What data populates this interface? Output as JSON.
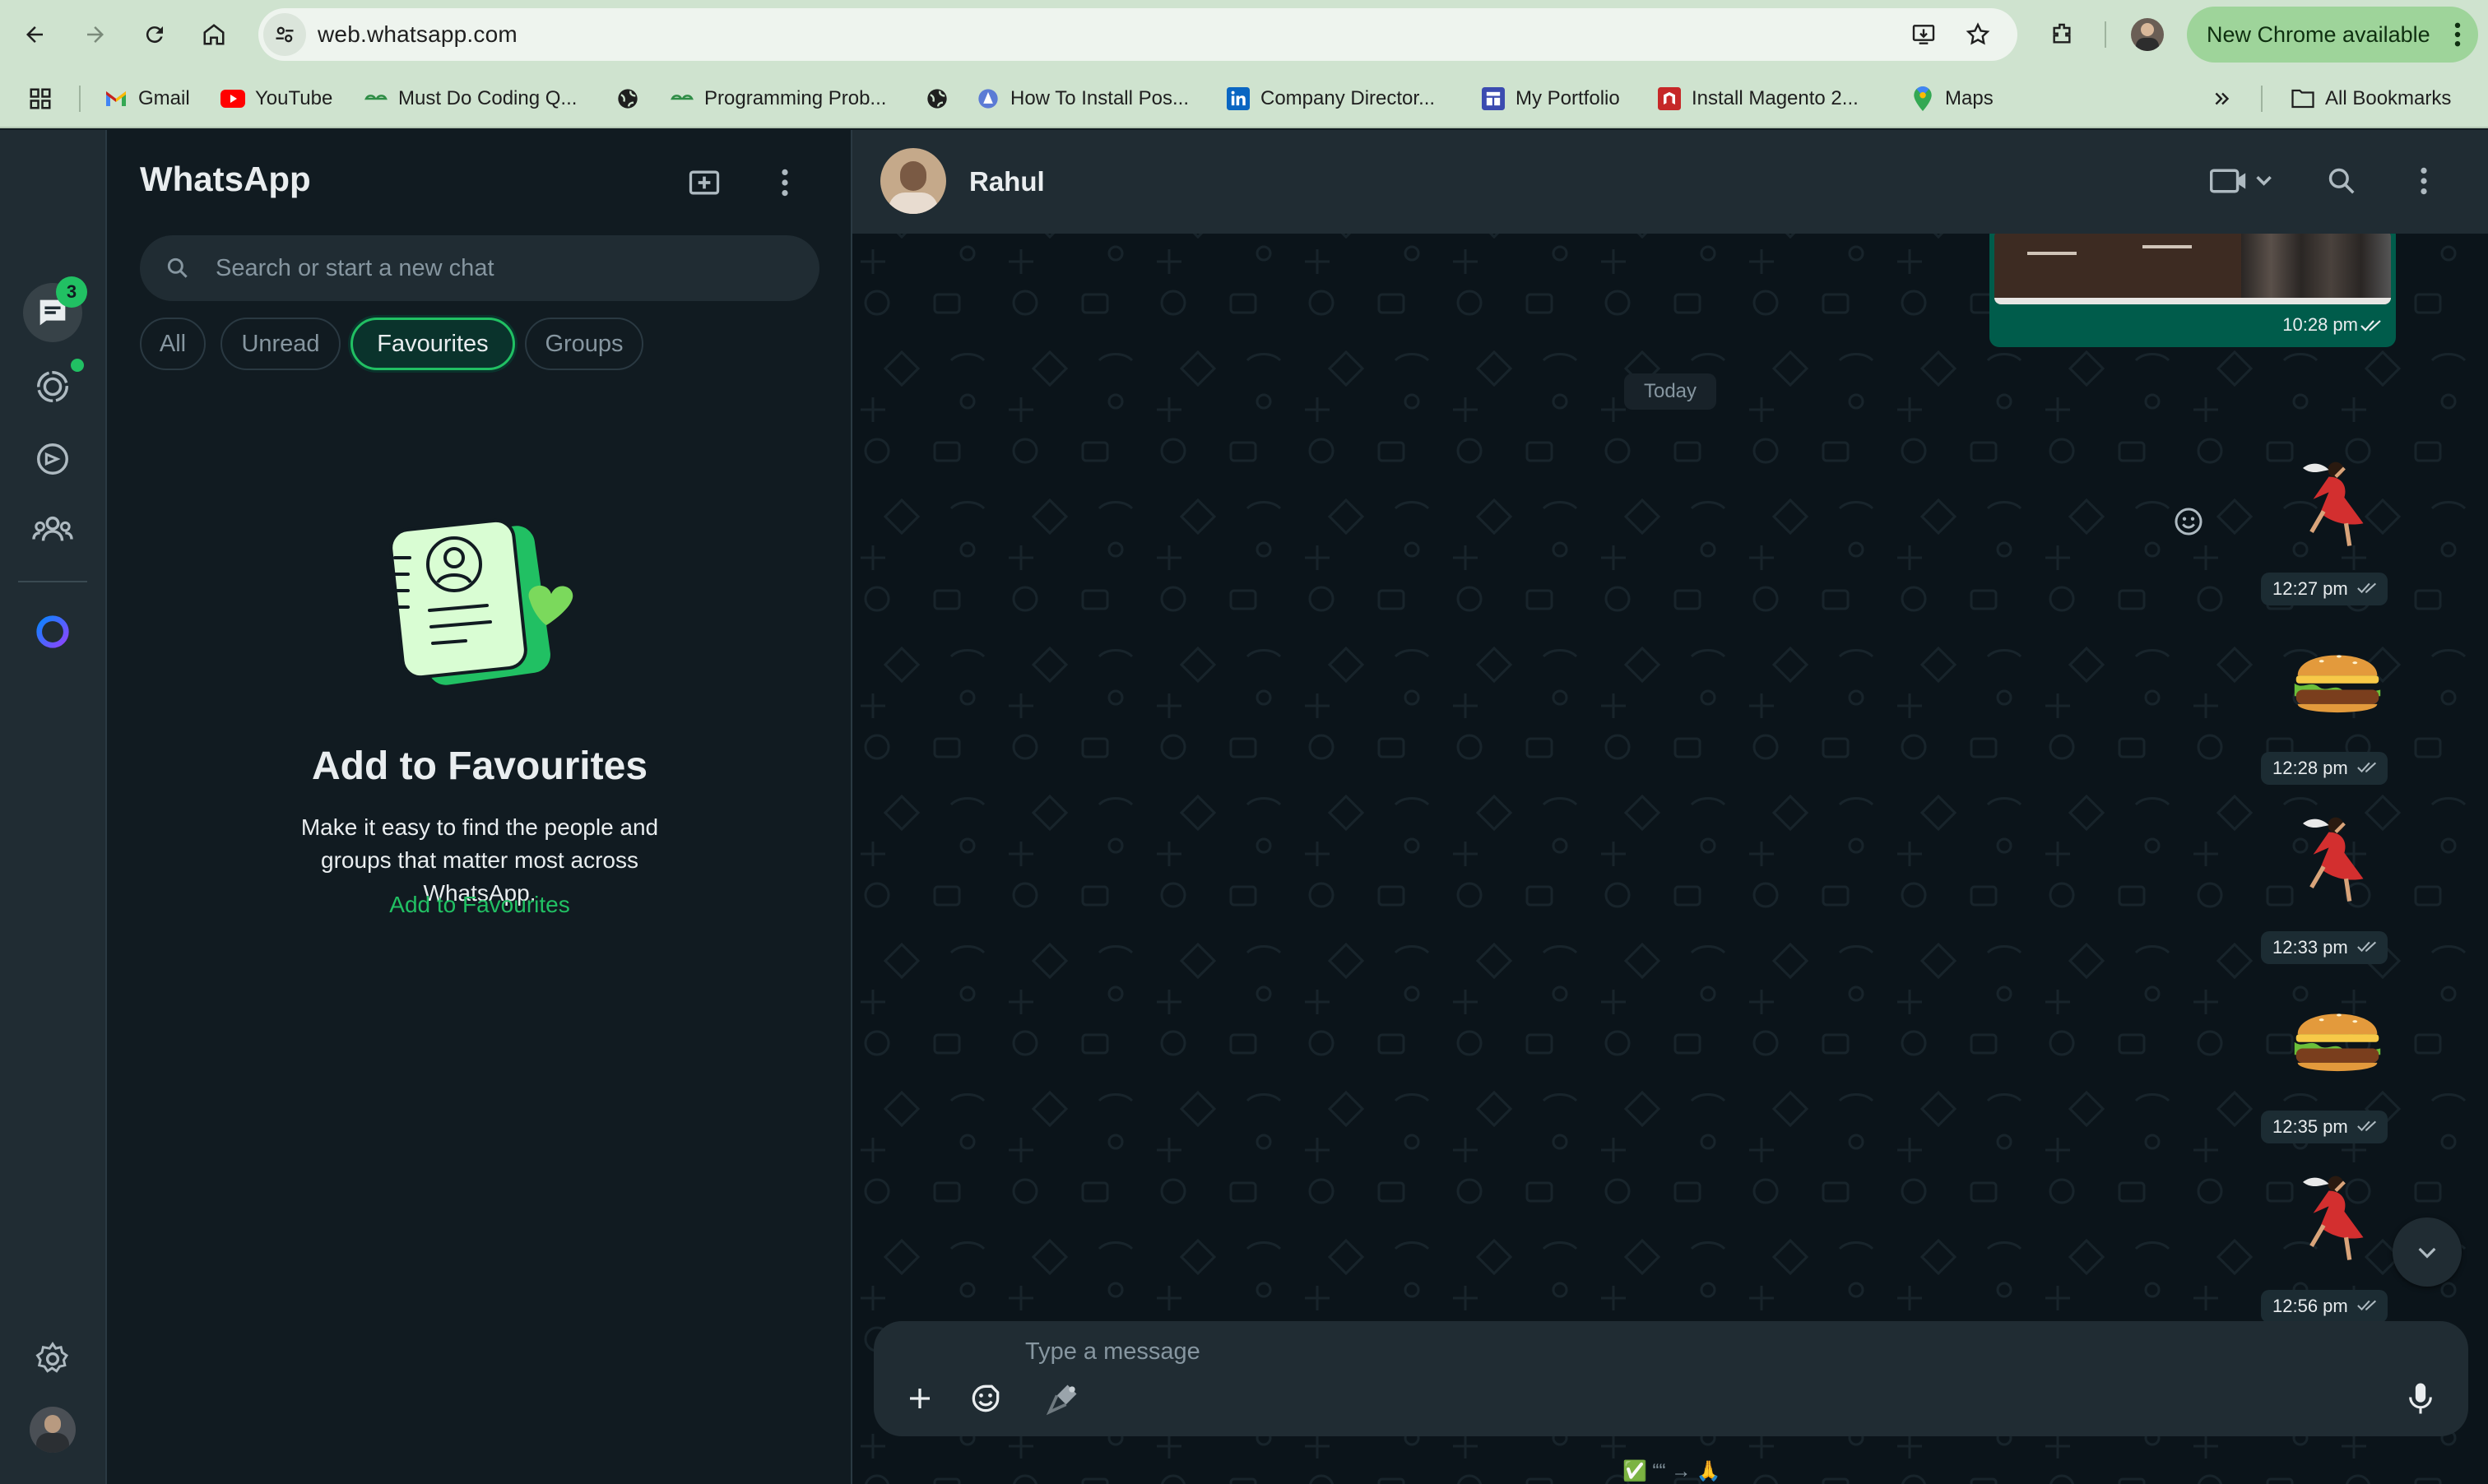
{
  "browser": {
    "url": "web.whatsapp.com",
    "update_button": "New Chrome available"
  },
  "bookmarks": {
    "items": [
      {
        "label": "Gmail",
        "icon": "gmail-icon"
      },
      {
        "label": "YouTube",
        "icon": "youtube-icon"
      },
      {
        "label": "Must Do Coding Q...",
        "icon": "geeksforgeeks-icon"
      },
      {
        "label": "",
        "icon": "globe-icon"
      },
      {
        "label": "Programming Prob...",
        "icon": "geeksforgeeks-icon"
      },
      {
        "label": "",
        "icon": "globe-icon"
      },
      {
        "label": "How To Install Pos...",
        "icon": "site-icon"
      },
      {
        "label": "Company Director...",
        "icon": "linkedin-icon"
      },
      {
        "label": "My Portfolio",
        "icon": "portfolio-icon"
      },
      {
        "label": "Install Magento 2...",
        "icon": "magento-icon"
      },
      {
        "label": "Maps",
        "icon": "maps-icon"
      }
    ],
    "all_bookmarks": "All Bookmarks"
  },
  "rail": {
    "chats_badge": "3"
  },
  "sidebar": {
    "title": "WhatsApp",
    "search_placeholder": "Search or start a new chat",
    "filters": [
      "All",
      "Unread",
      "Favourites",
      "Groups"
    ],
    "active_filter": "Favourites",
    "empty": {
      "title": "Add to Favourites",
      "description": "Make it easy to find the people and groups that matter most across WhatsApp.",
      "link": "Add to Favourites"
    }
  },
  "conversation": {
    "contact_name": "Rahul",
    "day_separator": "Today",
    "messages": [
      {
        "type": "image",
        "time": "10:28 pm",
        "status": "read"
      },
      {
        "type": "sticker",
        "sticker": "dancing-woman-sticker",
        "time": "12:27 pm",
        "status": "read"
      },
      {
        "type": "sticker",
        "sticker": "burger-sticker",
        "time": "12:28 pm",
        "status": "read"
      },
      {
        "type": "sticker",
        "sticker": "dancing-woman-sticker",
        "time": "12:33 pm",
        "status": "read"
      },
      {
        "type": "sticker",
        "sticker": "burger-sticker",
        "time": "12:35 pm",
        "status": "read"
      },
      {
        "type": "sticker",
        "sticker": "dancing-woman-sticker",
        "time": "12:56 pm",
        "status": "read"
      }
    ],
    "composer_placeholder": "Type a message",
    "bottom_hint": "✅ ““ → 🙏"
  },
  "colors": {
    "accent": "#21c063",
    "panel_bg": "#111b21",
    "header_bg": "#202c33",
    "outgoing_bubble": "#005c4b",
    "chrome_bar": "#cfe3cf"
  }
}
